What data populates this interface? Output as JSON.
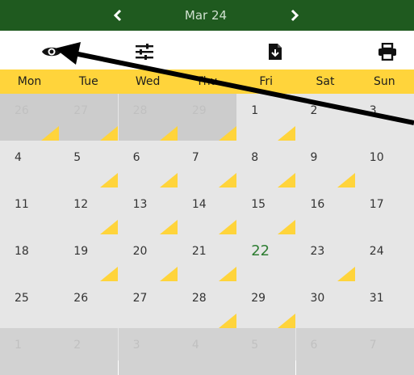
{
  "header": {
    "prev_icon": "chevron-left-icon",
    "title": "Mar 24",
    "next_icon": "chevron-right-icon",
    "bg_color": "#1f5a1f"
  },
  "toolbar": {
    "icons": [
      "eye-icon",
      "sliders-icon",
      "file-download-icon",
      "print-icon"
    ]
  },
  "weekdays": [
    "Mon",
    "Tue",
    "Wed",
    "Thu",
    "Fri",
    "Sat",
    "Sun"
  ],
  "weeks": [
    [
      {
        "day": "26",
        "dim": true,
        "prev": true,
        "marked": true
      },
      {
        "day": "27",
        "dim": true,
        "prev": true,
        "marked": true
      },
      {
        "day": "28",
        "dim": true,
        "prev": true,
        "marked": true
      },
      {
        "day": "29",
        "dim": true,
        "prev": true,
        "marked": true
      },
      {
        "day": "1",
        "dim": false,
        "marked": true
      },
      {
        "day": "2",
        "dim": false,
        "marked": false
      },
      {
        "day": "3",
        "dim": false,
        "marked": false
      }
    ],
    [
      {
        "day": "4",
        "marked": false
      },
      {
        "day": "5",
        "marked": true
      },
      {
        "day": "6",
        "marked": true
      },
      {
        "day": "7",
        "marked": true
      },
      {
        "day": "8",
        "marked": true
      },
      {
        "day": "9",
        "marked": true
      },
      {
        "day": "10",
        "marked": false
      }
    ],
    [
      {
        "day": "11",
        "marked": false
      },
      {
        "day": "12",
        "marked": true
      },
      {
        "day": "13",
        "marked": true
      },
      {
        "day": "14",
        "marked": true
      },
      {
        "day": "15",
        "marked": true
      },
      {
        "day": "16",
        "marked": false
      },
      {
        "day": "17",
        "marked": false
      }
    ],
    [
      {
        "day": "18",
        "marked": false
      },
      {
        "day": "19",
        "marked": true
      },
      {
        "day": "20",
        "marked": true
      },
      {
        "day": "21",
        "marked": true
      },
      {
        "day": "22",
        "today": true,
        "marked": false
      },
      {
        "day": "23",
        "marked": true
      },
      {
        "day": "24",
        "marked": false
      }
    ],
    [
      {
        "day": "25",
        "marked": false
      },
      {
        "day": "26",
        "marked": false
      },
      {
        "day": "27",
        "marked": false
      },
      {
        "day": "28",
        "marked": true
      },
      {
        "day": "29",
        "marked": true
      },
      {
        "day": "30",
        "marked": false
      },
      {
        "day": "31",
        "marked": false
      }
    ],
    [
      {
        "day": "1",
        "dim": true,
        "next": true,
        "marked": false
      },
      {
        "day": "2",
        "dim": true,
        "next": true,
        "marked": false
      },
      {
        "day": "3",
        "dim": true,
        "next": true,
        "marked": false
      },
      {
        "day": "4",
        "dim": true,
        "next": true,
        "marked": false
      },
      {
        "day": "5",
        "dim": true,
        "next": true,
        "marked": false
      },
      {
        "day": "6",
        "dim": true,
        "next": true,
        "marked": false
      },
      {
        "day": "7",
        "dim": true,
        "next": true,
        "marked": false
      }
    ]
  ],
  "colors": {
    "accent_yellow": "#ffd43b",
    "today_green": "#2e7d32",
    "arrow": "#000000"
  }
}
